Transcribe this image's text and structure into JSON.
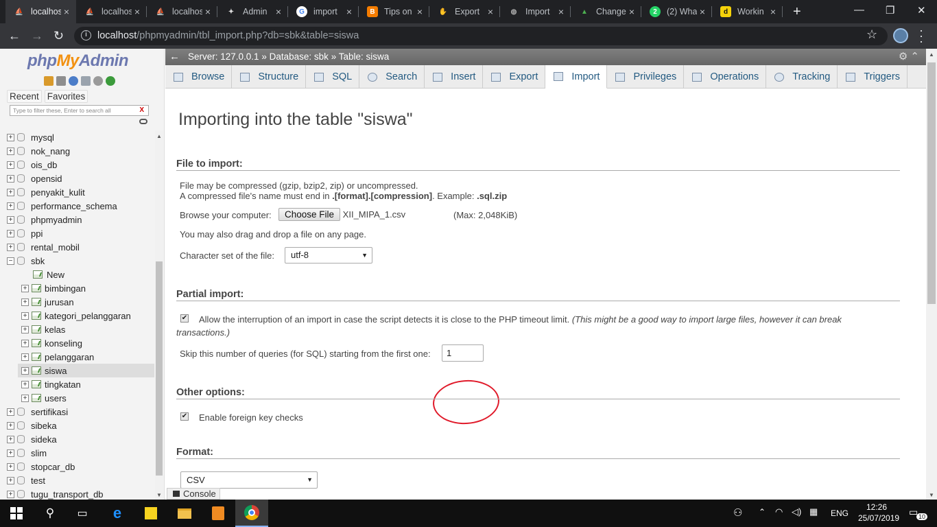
{
  "browser": {
    "tabs": [
      {
        "title": "localhost",
        "icon": "phpmyadmin-icon",
        "active": true
      },
      {
        "title": "localhost",
        "icon": "phpmyadmin-icon"
      },
      {
        "title": "localhost",
        "icon": "phpmyadmin-icon"
      },
      {
        "title": "Admin",
        "icon": "admin-icon"
      },
      {
        "title": "import",
        "icon": "google-icon"
      },
      {
        "title": "Tips on",
        "icon": "blogger-icon"
      },
      {
        "title": "Export",
        "icon": "hand-icon"
      },
      {
        "title": "Import",
        "icon": "globe-icon"
      },
      {
        "title": "Change",
        "icon": "colors-icon"
      },
      {
        "title": "(2) Wha",
        "icon": "whatsapp-icon"
      },
      {
        "title": "Workin",
        "icon": "dictionary-icon"
      }
    ],
    "url_host": "localhost",
    "url_path": "/phpmyadmin/tbl_import.php?db=sbk&table=siswa"
  },
  "left_panel": {
    "logo_php": "php",
    "logo_my": "My",
    "logo_admin": "Admin",
    "recent": "Recent",
    "favorites": "Favorites",
    "filter_placeholder": "Type to filter these, Enter to search all",
    "filter_clear": "X",
    "databases": [
      "mysql",
      "nok_nang",
      "ois_db",
      "opensid",
      "penyakit_kulit",
      "performance_schema",
      "phpmyadmin",
      "ppi",
      "rental_mobil",
      "sbk"
    ],
    "sbk_new": "New",
    "sbk_tables": [
      "bimbingan",
      "jurusan",
      "kategori_pelanggaran",
      "kelas",
      "konseling",
      "pelanggaran",
      "siswa",
      "tingkatan",
      "users"
    ],
    "databases_after": [
      "sertifikasi",
      "sibeka",
      "sideka",
      "slim",
      "stopcar_db",
      "test",
      "tugu_transport_db"
    ]
  },
  "breadcrumb": {
    "server": "Server: 127.0.0.1",
    "database": "Database: sbk",
    "table": "Table: siswa",
    "sep": "»"
  },
  "menu": [
    "Browse",
    "Structure",
    "SQL",
    "Search",
    "Insert",
    "Export",
    "Import",
    "Privileges",
    "Operations",
    "Tracking",
    "Triggers"
  ],
  "main": {
    "title": "Importing into the table \"siswa\"",
    "file_section": "File to import:",
    "compress_line1": "File may be compressed (gzip, bzip2, zip) or uncompressed.",
    "compress_line2a": "A compressed file's name must end in ",
    "compress_line2b": ".[format].[compression]",
    "compress_line2c": ". Example: ",
    "compress_line2d": ".sql.zip",
    "browse_label": "Browse your computer:",
    "choose_file": "Choose File",
    "file_name": "XII_MIPA_1.csv",
    "max_size": "(Max: 2,048KiB)",
    "drag_drop": "You may also drag and drop a file on any page.",
    "charset_label": "Character set of the file:",
    "charset_value": "utf-8",
    "partial_section": "Partial import:",
    "allow_interrupt": "Allow the interruption of an import in case the script detects it is close to the PHP timeout limit.",
    "allow_interrupt_note1": "(This might be a good way to import large files, however it can break",
    "allow_interrupt_note2": "transactions.)",
    "skip_label": "Skip this number of queries (for SQL) starting from the first one:",
    "skip_value": "1",
    "other_section": "Other options:",
    "fk_checks": "Enable foreign key checks",
    "format_section": "Format:",
    "format_value": "CSV",
    "console": "Console"
  },
  "taskbar": {
    "language": "ENG",
    "time": "12:26",
    "date": "25/07/2019",
    "notifications": "10"
  }
}
